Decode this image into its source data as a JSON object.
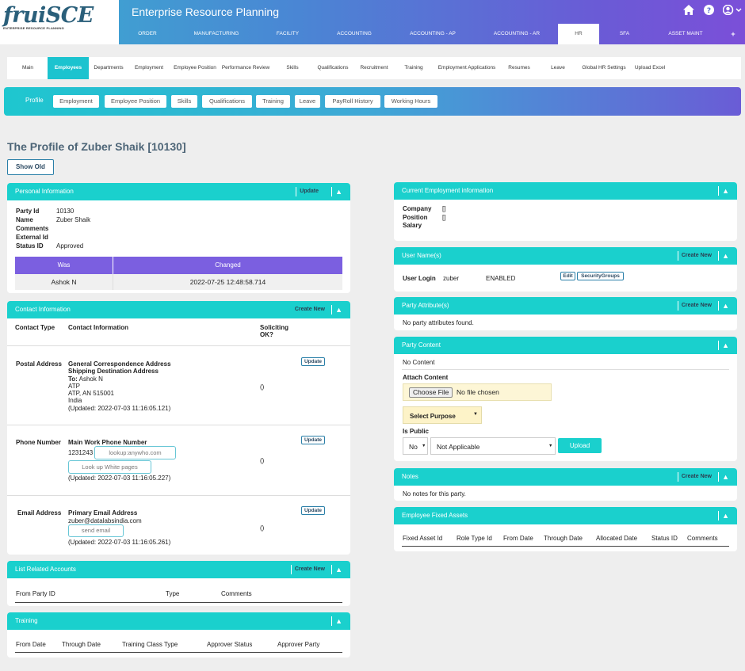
{
  "header": {
    "logo": "fruiSCE",
    "logo_sub": "ENTERPRISE RESOURCE PLANNING",
    "app_title": "Enterprise Resource Planning",
    "nav": [
      "ORDER",
      "MANUFACTURING",
      "FACILITY",
      "ACCOUNTING",
      "ACCOUNTING - AP",
      "ACCOUNTING - AR",
      "HR",
      "SFA",
      "ASSET MAINT",
      "+"
    ],
    "icons": [
      "home-icon",
      "help-icon",
      "user-icon"
    ]
  },
  "subnav": [
    "Main",
    "Employees",
    "Departments",
    "Employment",
    "Employee Position",
    "Performance Review",
    "Skills",
    "Qualifications",
    "Recruitment",
    "Training",
    "Employment Applications",
    "Resumes",
    "Leave",
    "Global HR Settings",
    "Upload Excel"
  ],
  "profile_tabs": {
    "active": "Profile",
    "tabs": [
      "Employment",
      "Employee Position",
      "Skills",
      "Qualifications",
      "Training",
      "Leave",
      "PayRoll History",
      "Working Hours"
    ]
  },
  "page_title": "The Profile of Zuber Shaik [10130]",
  "show_old": "Show Old",
  "personal": {
    "title": "Personal Information",
    "update": "Update",
    "labels": [
      "Party Id",
      "Name",
      "Comments",
      "External Id",
      "Status ID"
    ],
    "values": [
      "10130",
      "Zuber Shaik",
      "",
      "",
      "Approved"
    ],
    "hist_headers": [
      "Was",
      "Changed"
    ],
    "hist_row": [
      "Ashok N",
      "2022-07-25 12:48:58.714"
    ]
  },
  "contact": {
    "title": "Contact Information",
    "create_new": "Create New",
    "headers": [
      "Contact Type",
      "Contact Information",
      "Soliciting",
      "OK?"
    ],
    "postal": {
      "type": "Postal Address",
      "l1": "General Correspondence Address",
      "l2": "Shipping Destination Address",
      "to": "To:",
      "name": "Ashok N",
      "l4": "ATP",
      "l5": "ATP, AN 515001",
      "l6": "India",
      "updated": "(Updated: 2022-07-03 11:16:05.121)",
      "sol": "()",
      "btn": "Update"
    },
    "phone": {
      "type": "Phone Number",
      "l1": "Main Work Phone Number",
      "num": "1231243",
      "lookup": "lookup:anywho.com",
      "white": "Look up White pages",
      "updated": "(Updated: 2022-07-03 11:16:05.227)",
      "sol": "()",
      "btn": "Update"
    },
    "email": {
      "type": "Email Address",
      "l1": "Primary Email Address",
      "addr": "zuber@datalabsindia.com",
      "send": "send email",
      "updated": "(Updated: 2022-07-03 11:16:05.261)",
      "sol": "()",
      "btn": "Update"
    }
  },
  "related": {
    "title": "List Related Accounts",
    "create_new": "Create New",
    "headers": [
      "From Party ID",
      "Type",
      "Comments"
    ]
  },
  "training": {
    "title": "Training",
    "headers": [
      "From Date",
      "Through Date",
      "Training Class Type",
      "Approver Status",
      "Approver Party"
    ]
  },
  "employment": {
    "title": "Current Employment information",
    "labels": [
      "Company",
      "Position",
      "Salary"
    ],
    "values": [
      "[]",
      "[]",
      ""
    ]
  },
  "username": {
    "title": "User Name(s)",
    "create_new": "Create New",
    "label": "User Login",
    "login": "zuber",
    "status": "ENABLED",
    "edit": "Edit",
    "groups": "SecurityGroups"
  },
  "attributes": {
    "title": "Party Attribute(s)",
    "create_new": "Create New",
    "empty": "No party attributes found."
  },
  "content": {
    "title": "Party Content",
    "empty": "No Content",
    "attach": "Attach Content",
    "choose": "Choose File",
    "nofile": "No file chosen",
    "purpose": "Select Purpose",
    "is_public": "Is Public",
    "public_val": "No",
    "applicable": "Not Applicable",
    "upload": "Upload"
  },
  "notes": {
    "title": "Notes",
    "create_new": "Create New",
    "empty": "No notes for this party."
  },
  "assets": {
    "title": "Employee Fixed Assets",
    "headers": [
      "Fixed Asset Id",
      "Role Type Id",
      "From Date",
      "Through Date",
      "Allocated Date",
      "Status ID",
      "Comments"
    ]
  }
}
